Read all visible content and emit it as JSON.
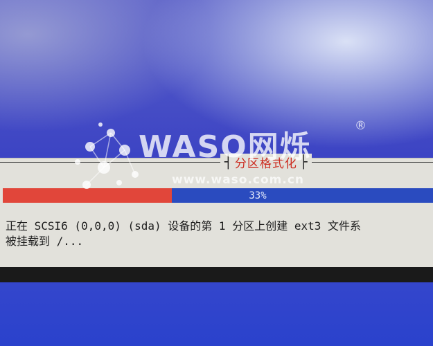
{
  "dialog": {
    "title": "分区格式化",
    "title_left_bracket": "┤",
    "title_right_bracket": "├"
  },
  "progress": {
    "percent": 33,
    "label": "33%"
  },
  "status": {
    "line1": "正在 SCSI6 (0,0,0) (sda) 设备的第 1 分区上创建 ext3 文件系",
    "line2": "被挂载到 /..."
  },
  "watermark": {
    "brand": "WASO网烁",
    "registered": "®",
    "url": "www.waso.com.cn"
  },
  "colors": {
    "progress_fill": "#e1463a",
    "progress_track": "#2a4bbf",
    "title_text": "#cc2b1f",
    "dialog_bg": "#e2e1db",
    "desktop_blue": "#3446cc"
  }
}
